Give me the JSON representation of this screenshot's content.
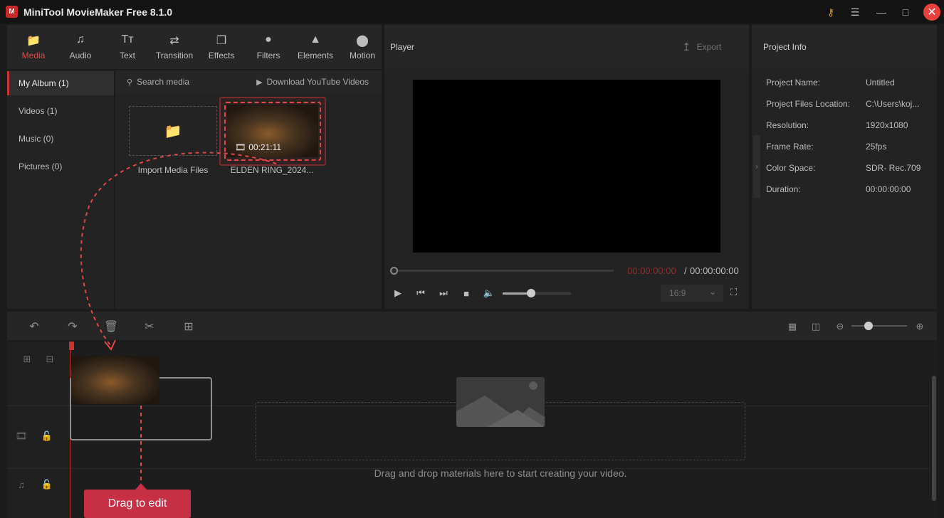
{
  "app": {
    "title": "MiniTool MovieMaker Free 8.1.0",
    "logo_text": "M"
  },
  "titlebar": {
    "key_icon": "key-icon",
    "menu_icon": "hamburger-icon",
    "minimize_icon": "minimize-icon",
    "maximize_icon": "maximize-icon",
    "close_icon": "close-icon"
  },
  "tool_tabs": [
    {
      "label": "Media",
      "icon": "folder-icon",
      "active": true
    },
    {
      "label": "Audio",
      "icon": "music-note-icon",
      "active": false
    },
    {
      "label": "Text",
      "icon": "text-icon",
      "active": false
    },
    {
      "label": "Transition",
      "icon": "transition-icon",
      "active": false
    },
    {
      "label": "Effects",
      "icon": "effects-icon",
      "active": false
    },
    {
      "label": "Filters",
      "icon": "filters-icon",
      "active": false
    },
    {
      "label": "Elements",
      "icon": "elements-icon",
      "active": false
    },
    {
      "label": "Motion",
      "icon": "motion-icon",
      "active": false
    }
  ],
  "album": [
    {
      "label": "My Album (1)",
      "active": true
    },
    {
      "label": "Videos (1)",
      "active": false
    },
    {
      "label": "Music (0)",
      "active": false
    },
    {
      "label": "Pictures (0)",
      "active": false
    }
  ],
  "media": {
    "search_placeholder": "Search media",
    "youtube_label": "Download YouTube Videos",
    "import_label": "Import Media Files",
    "clip_duration": "00:21:11",
    "clip_name": "ELDEN RING_2024..."
  },
  "player": {
    "title": "Player",
    "export_label": "Export",
    "current_time": "00:00:00:00",
    "separator": "/",
    "total_time": "00:00:00:00",
    "ratio": "16:9",
    "volume_level": 0.4
  },
  "project_info": {
    "title": "Project Info",
    "rows": [
      {
        "key": "Project Name:",
        "value": "Untitled"
      },
      {
        "key": "Project Files Location:",
        "value": "C:\\Users\\koj..."
      },
      {
        "key": "Resolution:",
        "value": "1920x1080"
      },
      {
        "key": "Frame Rate:",
        "value": "25fps"
      },
      {
        "key": "Color Space:",
        "value": "SDR- Rec.709"
      },
      {
        "key": "Duration:",
        "value": "00:00:00:00"
      }
    ]
  },
  "timeline": {
    "drop_text": "Drag and drop materials here to start creating your video.",
    "zoom_level": 0.3
  },
  "callout": {
    "label": "Drag to edit"
  },
  "colors": {
    "accent": "#e0494a",
    "callout": "#c72f45",
    "arrow": "#e24646"
  }
}
